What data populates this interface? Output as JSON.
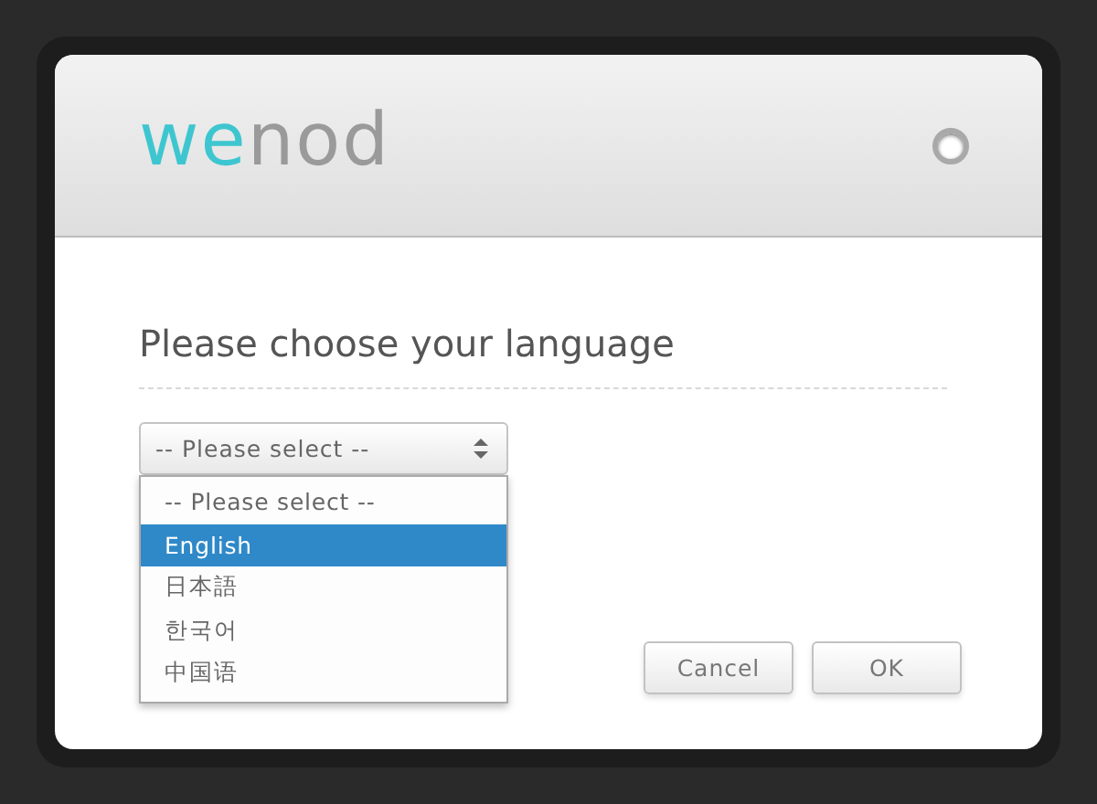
{
  "logo": {
    "parts": [
      {
        "text": "we",
        "color": "#3ec6d0"
      },
      {
        "text": "nod",
        "color": "#9a9a9a"
      }
    ]
  },
  "heading": "Please choose your language",
  "select": {
    "value": "-- Please select --",
    "expanded": true,
    "options": [
      {
        "label": "-- Please select --",
        "highlighted": false
      },
      {
        "label": "English",
        "highlighted": true
      },
      {
        "label": "日本語",
        "highlighted": false
      },
      {
        "label": "한국어",
        "highlighted": false
      },
      {
        "label": "中国语",
        "highlighted": false
      }
    ]
  },
  "buttons": [
    "Cancel",
    "OK"
  ]
}
